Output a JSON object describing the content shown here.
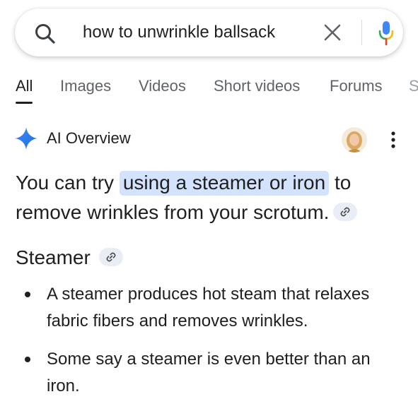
{
  "search": {
    "query": "how to unwrinkle ballsack",
    "icons": [
      "search-icon",
      "close-icon",
      "microphone-icon"
    ]
  },
  "tabs": [
    {
      "label": "All",
      "active": true
    },
    {
      "label": "Images",
      "active": false
    },
    {
      "label": "Videos",
      "active": false
    },
    {
      "label": "Short videos",
      "active": false
    },
    {
      "label": "Forums",
      "active": false
    },
    {
      "label": "S",
      "active": false
    }
  ],
  "ai_overview": {
    "title": "AI Overview",
    "icons": [
      "sparkle-icon",
      "avatar",
      "more-vertical-icon"
    ],
    "answer": {
      "before": "You can try ",
      "highlight": "using a steamer or iron",
      "after": " to remove wrinkles from your scrotum."
    },
    "section": {
      "heading": "Steamer",
      "bullets": [
        "A steamer produces hot steam that relaxes fabric fibers and removes wrinkles.",
        "Some say a steamer is even better than an iron."
      ]
    }
  },
  "colors": {
    "highlight": "#d3e3fd",
    "link_chip": "#e9eef6",
    "text": "#1f1f1f",
    "tab_inactive": "#5f6368",
    "mic_blue": "#4285f4",
    "mic_red": "#ea4335",
    "mic_yellow": "#fbbc04",
    "mic_green": "#34a853"
  }
}
